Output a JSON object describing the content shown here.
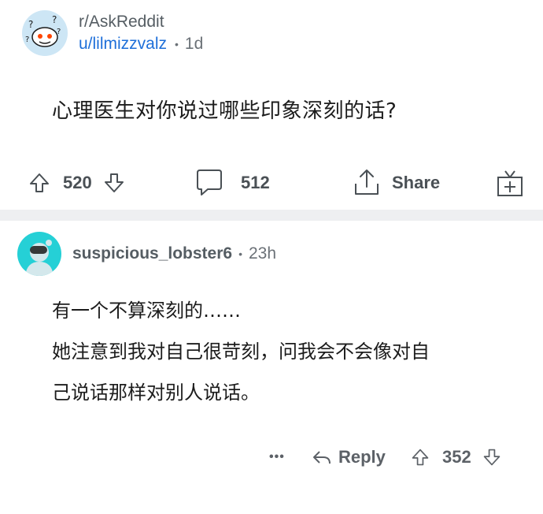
{
  "post": {
    "subreddit": "r/AskReddit",
    "author": "u/lilmizzvalz",
    "age": "1d",
    "title": "心理医生对你说过哪些印象深刻的话?",
    "upvotes": "520",
    "comments": "512",
    "share_label": "Share"
  },
  "comment": {
    "author": "suspicious_lobster6",
    "age": "23h",
    "lines": [
      "有一个不算深刻的……",
      "她注意到我对自己很苛刻，问我会不会像对自",
      "己说话那样对别人说话。"
    ],
    "more_label": "•••",
    "reply_label": "Reply",
    "votes": "352"
  },
  "icons": {
    "subreddit_avatar": "reddit-snoo-question-icon",
    "comment_avatar": "reddit-snoo-icon",
    "upvote": "arrow-up-icon",
    "downvote": "arrow-down-icon",
    "comment": "speech-bubble-icon",
    "share": "share-icon",
    "award": "gift-icon",
    "reply": "reply-arrow-icon"
  },
  "colors": {
    "username_link": "#1e6fd9",
    "subreddit_avatar_bg": "#cde6f5",
    "comment_avatar_bg": "#25d0d6",
    "divider": "#eeeff1"
  }
}
